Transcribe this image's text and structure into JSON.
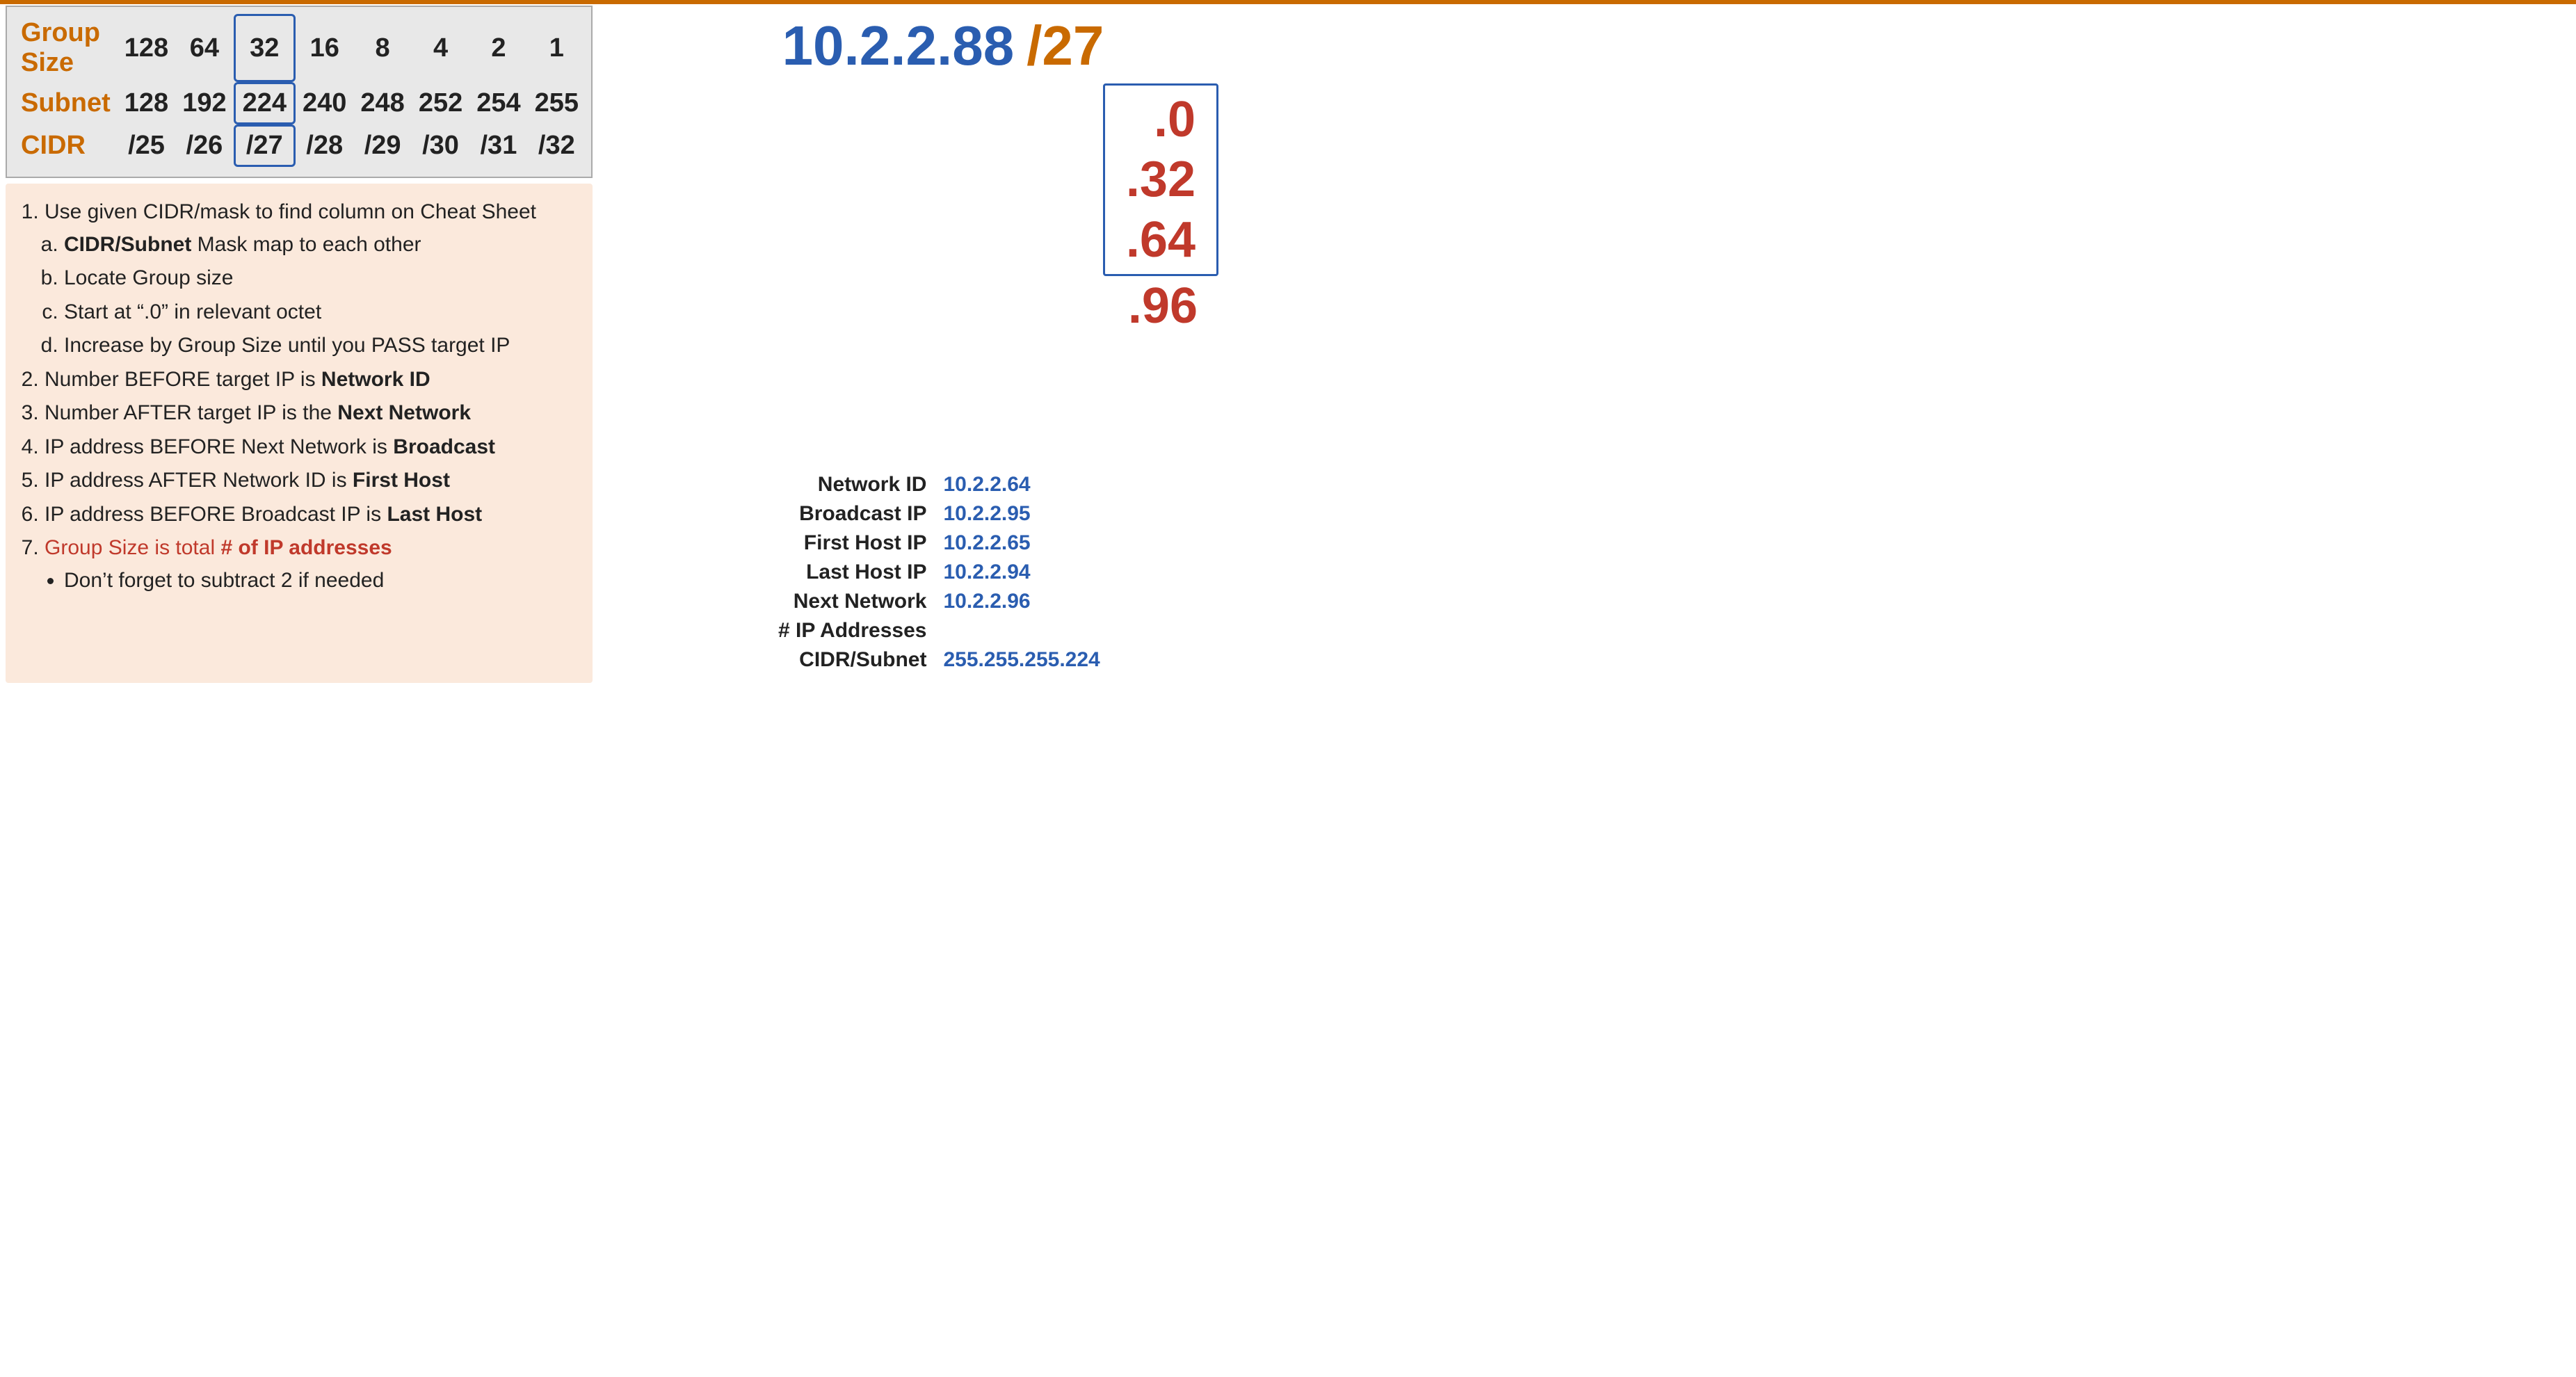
{
  "cheatSheet": {
    "rows": [
      {
        "label": "Group Size",
        "values": [
          "128",
          "64",
          "32",
          "16",
          "8",
          "4",
          "2",
          "1"
        ],
        "highlightIndex": 2
      },
      {
        "label": "Subnet",
        "values": [
          "128",
          "192",
          "224",
          "240",
          "248",
          "252",
          "254",
          "255"
        ],
        "highlightIndex": 2
      },
      {
        "label": "CIDR",
        "values": [
          "/25",
          "/26",
          "/27",
          "/28",
          "/29",
          "/30",
          "/31",
          "/32"
        ],
        "highlightIndex": 2
      }
    ]
  },
  "instructions": {
    "items": [
      {
        "text": "Use given CIDR/mask to find column on Cheat Sheet",
        "subItems": [
          {
            "text": "CIDR/Subnet",
            "rest": " Mask map to each other",
            "bold": true
          },
          {
            "text": "Locate Group size"
          },
          {
            "text": "Start at “.0” in relevant octet"
          },
          {
            "text": "Increase by Group Size until you PASS target IP"
          }
        ]
      },
      {
        "text": "Number BEFORE target IP is ",
        "boldPart": "Network ID"
      },
      {
        "text": "Number AFTER target IP is the ",
        "boldPart": "Next Network"
      },
      {
        "text": "IP address BEFORE Next Network is ",
        "boldPart": "Broadcast"
      },
      {
        "text": "IP address AFTER Network ID is ",
        "boldPart": "First Host"
      },
      {
        "text": "IP address BEFORE Broadcast IP is ",
        "boldPart": "Last Host"
      },
      {
        "text": "Group Size is total ",
        "boldPart": "# of IP addresses",
        "red": true
      },
      {
        "text": "Don’t forget to subtract 2 if needed",
        "bullet": true
      }
    ]
  },
  "ipHeader": {
    "address": "10.2.2.88",
    "cidr": "/27"
  },
  "subnetBlocks": {
    "insideBox": [
      ".0",
      ".32",
      ".64"
    ],
    "outsideBox": ".96"
  },
  "networkInfo": {
    "rows": [
      {
        "label": "Network ID",
        "value": "10.2.2.64"
      },
      {
        "label": "Broadcast IP",
        "value": "10.2.2.95"
      },
      {
        "label": "First Host IP",
        "value": "10.2.2.65"
      },
      {
        "label": "Last Host IP",
        "value": "10.2.2.94"
      },
      {
        "label": "Next Network",
        "value": "10.2.2.96"
      },
      {
        "label": "# IP Addresses",
        "value": ""
      },
      {
        "label": "CIDR/Subnet",
        "value": "255.255.255.224"
      }
    ]
  }
}
